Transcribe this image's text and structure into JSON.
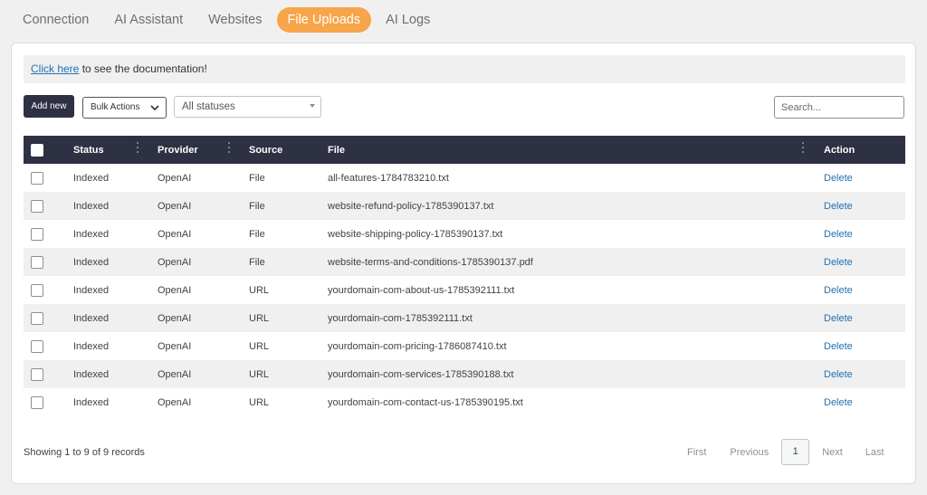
{
  "tabs": [
    {
      "label": "Connection",
      "active": false
    },
    {
      "label": "AI Assistant",
      "active": false
    },
    {
      "label": "Websites",
      "active": false
    },
    {
      "label": "File Uploads",
      "active": true
    },
    {
      "label": "AI Logs",
      "active": false
    }
  ],
  "notice": {
    "link": "Click here",
    "text": " to see the documentation!"
  },
  "toolbar": {
    "add_new": "Add new",
    "bulk_actions": "Bulk Actions",
    "status_filter": "All statuses",
    "search_placeholder": "Search..."
  },
  "table": {
    "headers": {
      "status": "Status",
      "provider": "Provider",
      "source": "Source",
      "file": "File",
      "action": "Action"
    },
    "rows": [
      {
        "status": "Indexed",
        "provider": "OpenAI",
        "source": "File",
        "file": "all-features-1784783210.txt",
        "action": "Delete"
      },
      {
        "status": "Indexed",
        "provider": "OpenAI",
        "source": "File",
        "file": "website-refund-policy-1785390137.txt",
        "action": "Delete"
      },
      {
        "status": "Indexed",
        "provider": "OpenAI",
        "source": "File",
        "file": "website-shipping-policy-1785390137.txt",
        "action": "Delete"
      },
      {
        "status": "Indexed",
        "provider": "OpenAI",
        "source": "File",
        "file": "website-terms-and-conditions-1785390137.pdf",
        "action": "Delete"
      },
      {
        "status": "Indexed",
        "provider": "OpenAI",
        "source": "URL",
        "file": "yourdomain-com-about-us-1785392111.txt",
        "action": "Delete"
      },
      {
        "status": "Indexed",
        "provider": "OpenAI",
        "source": "URL",
        "file": "yourdomain-com-1785392111.txt",
        "action": "Delete"
      },
      {
        "status": "Indexed",
        "provider": "OpenAI",
        "source": "URL",
        "file": "yourdomain-com-pricing-1786087410.txt",
        "action": "Delete"
      },
      {
        "status": "Indexed",
        "provider": "OpenAI",
        "source": "URL",
        "file": "yourdomain-com-services-1785390188.txt",
        "action": "Delete"
      },
      {
        "status": "Indexed",
        "provider": "OpenAI",
        "source": "URL",
        "file": "yourdomain-com-contact-us-1785390195.txt",
        "action": "Delete"
      }
    ]
  },
  "footer": {
    "summary": "Showing 1 to 9 of 9 records",
    "first": "First",
    "previous": "Previous",
    "page": "1",
    "next": "Next",
    "last": "Last"
  },
  "colors": {
    "accent": "#f7a54a",
    "header": "#2e3043",
    "link": "#2271b1"
  }
}
